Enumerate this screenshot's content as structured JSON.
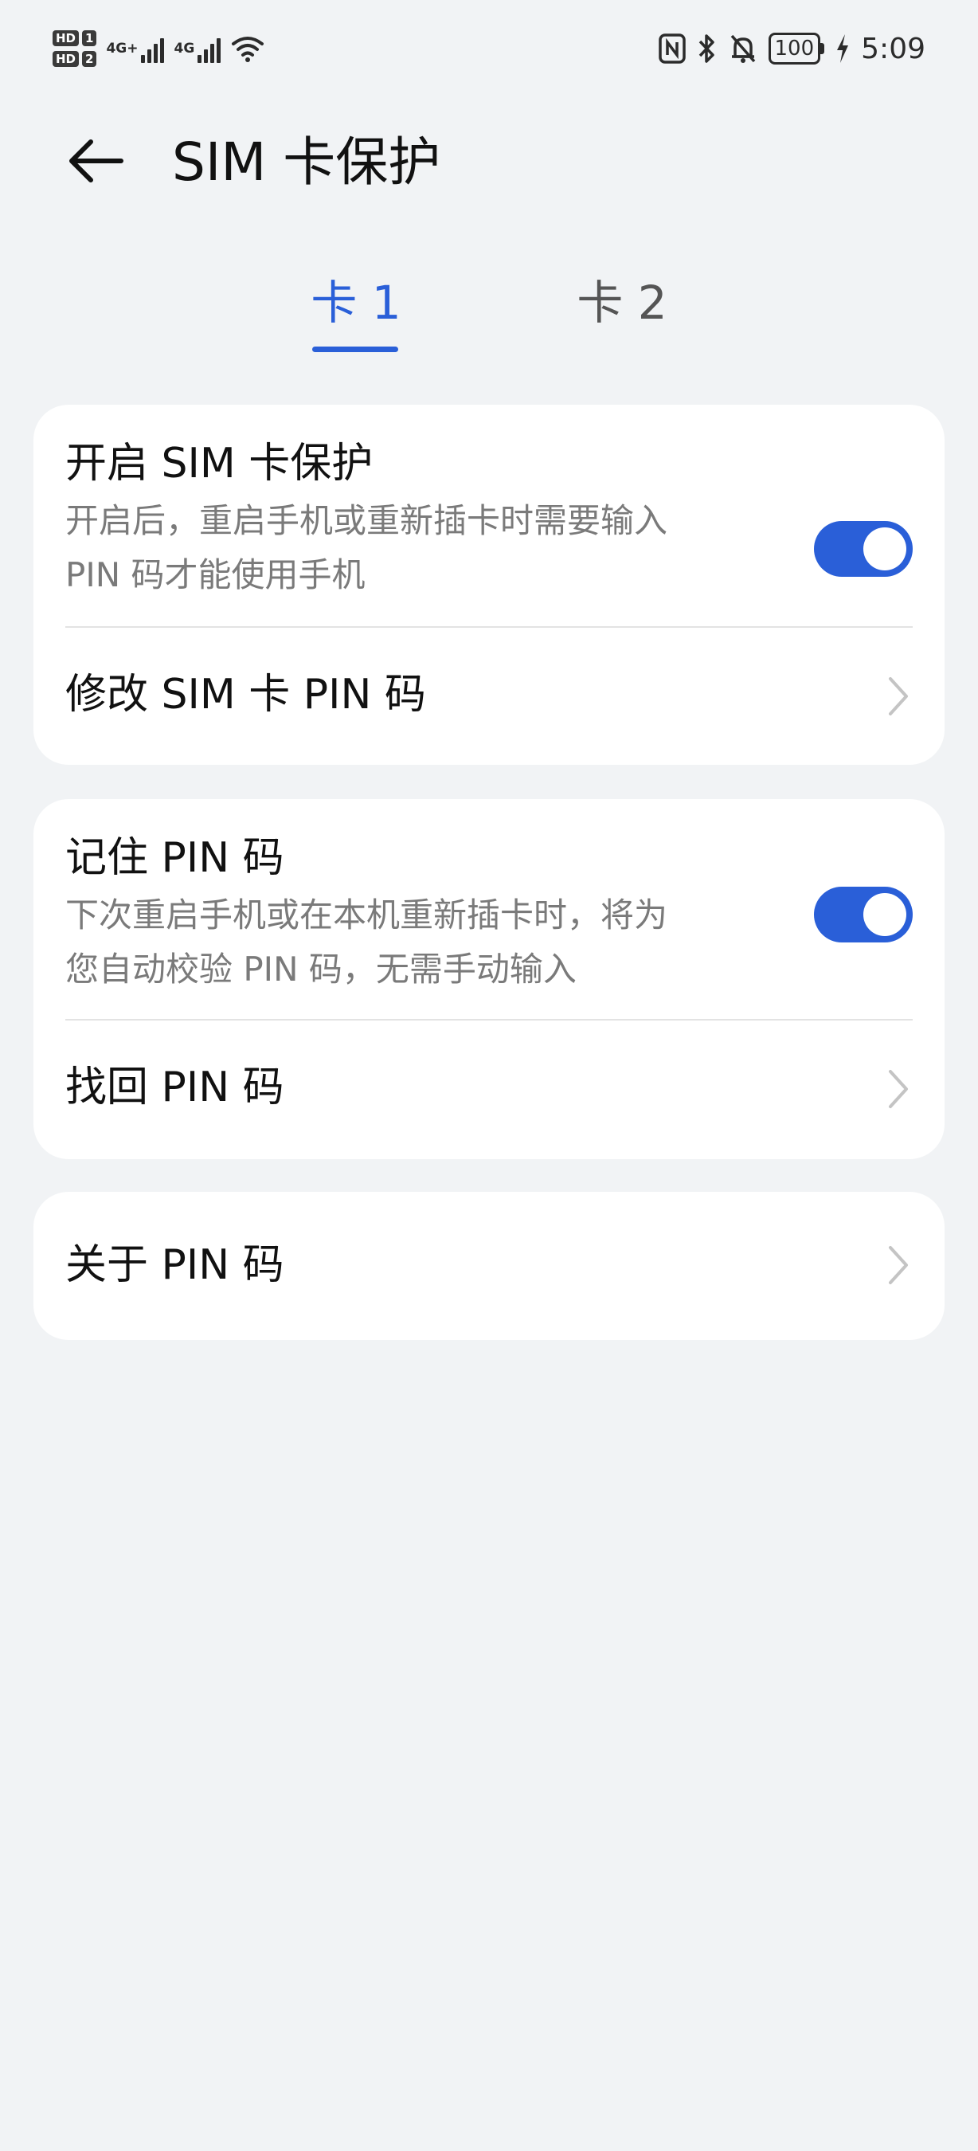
{
  "status_bar": {
    "sim1_label": "HD",
    "sim1_num": "1",
    "sim2_label": "HD",
    "sim2_num": "2",
    "net1": "4G+",
    "net2": "4G",
    "battery": "100",
    "time": "5:09",
    "icons": [
      "nfc-icon",
      "bluetooth-icon",
      "mute-icon",
      "battery-icon",
      "charging-icon",
      "wifi-icon"
    ]
  },
  "header": {
    "title": "SIM 卡保护"
  },
  "tabs": [
    {
      "label": "卡 1",
      "active": true
    },
    {
      "label": "卡 2",
      "active": false
    }
  ],
  "accent_color": "#2a5fd8",
  "cards": {
    "protect": {
      "title": "开启 SIM 卡保护",
      "desc_line1": "开启后，重启手机或重新插卡时需要输入",
      "desc_line2": "PIN 码才能使用手机",
      "enabled": true
    },
    "change_pin": {
      "title": "修改 SIM 卡 PIN 码"
    },
    "remember": {
      "title": "记住 PIN 码",
      "desc_line1": "下次重启手机或在本机重新插卡时，将为",
      "desc_line2": "您自动校验 PIN 码，无需手动输入",
      "enabled": true
    },
    "recover_pin": {
      "title": "找回 PIN 码"
    },
    "about_pin": {
      "title": "关于 PIN 码"
    }
  }
}
